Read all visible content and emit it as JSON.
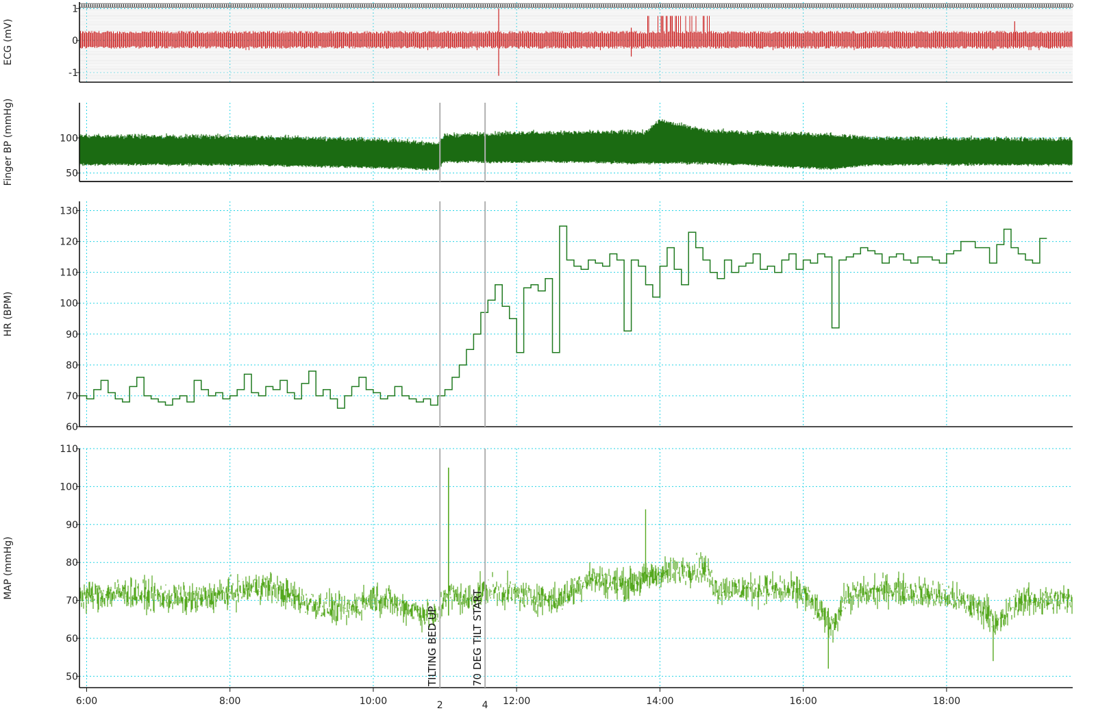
{
  "chart_data": {
    "type": "line",
    "x_tick_labels": [
      "6:00",
      "8:00",
      "10:00",
      "12:00",
      "14:00",
      "16:00",
      "18:00"
    ],
    "x_tick_hours": [
      6,
      8,
      10,
      12,
      14,
      16,
      18
    ],
    "x_range_hours": [
      5.9,
      19.76
    ],
    "grid": true,
    "colors": {
      "ecg": "#cc2222",
      "finger_bp": "#1b6b12",
      "hr": "#1f7a1f",
      "map": "#55a81e",
      "grid": "#22d3e6",
      "marker": "#b0b0b0"
    },
    "markers": [
      {
        "id": "2",
        "number": "2",
        "hour": 10.93,
        "label": "TILTING BED UP"
      },
      {
        "id": "4",
        "number": "4",
        "hour": 11.56,
        "label": "70 DEG TILT START"
      }
    ],
    "panels": [
      {
        "key": "ecg",
        "ylabel": "ECG (mV)",
        "ylim": [
          -1.3,
          1.2
        ],
        "yticks": [
          -1,
          0,
          1
        ],
        "ytick_labels": [
          "-1",
          "0",
          "1"
        ]
      },
      {
        "key": "finger_bp",
        "ylabel": "Finger BP (mmHg)",
        "ylim": [
          38,
          150
        ],
        "yticks": [
          50,
          100
        ],
        "ytick_labels": [
          "50",
          "100"
        ]
      },
      {
        "key": "hr",
        "ylabel": "HR (BPM)",
        "ylim": [
          60,
          133
        ],
        "yticks": [
          60,
          70,
          80,
          90,
          100,
          110,
          120,
          130
        ],
        "ytick_labels": [
          "60",
          "70",
          "80",
          "90",
          "100",
          "110",
          "120",
          "130"
        ],
        "series": {
          "name": "",
          "step": true,
          "x": [
            5.9,
            6.0,
            6.1,
            6.2,
            6.3,
            6.4,
            6.5,
            6.6,
            6.7,
            6.8,
            6.9,
            7.0,
            7.1,
            7.2,
            7.3,
            7.4,
            7.5,
            7.6,
            7.7,
            7.8,
            7.9,
            8.0,
            8.1,
            8.2,
            8.3,
            8.4,
            8.5,
            8.6,
            8.7,
            8.8,
            8.9,
            9.0,
            9.1,
            9.2,
            9.3,
            9.4,
            9.5,
            9.6,
            9.7,
            9.8,
            9.9,
            10.0,
            10.1,
            10.2,
            10.3,
            10.4,
            10.5,
            10.6,
            10.7,
            10.8,
            10.9,
            11.0,
            11.1,
            11.2,
            11.3,
            11.4,
            11.5,
            11.6,
            11.7,
            11.8,
            11.9,
            12.0,
            12.1,
            12.2,
            12.3,
            12.4,
            12.5,
            12.6,
            12.7,
            12.8,
            12.9,
            13.0,
            13.1,
            13.2,
            13.3,
            13.4,
            13.5,
            13.6,
            13.7,
            13.8,
            13.9,
            14.0,
            14.1,
            14.2,
            14.3,
            14.4,
            14.5,
            14.6,
            14.7,
            14.8,
            14.9,
            15.0,
            15.1,
            15.2,
            15.3,
            15.4,
            15.5,
            15.6,
            15.7,
            15.8,
            15.9,
            16.0,
            16.1,
            16.2,
            16.3,
            16.4,
            16.5,
            16.6,
            16.7,
            16.8,
            16.9,
            17.0,
            17.1,
            17.2,
            17.3,
            17.4,
            17.5,
            17.6,
            17.7,
            17.8,
            17.9,
            18.0,
            18.1,
            18.2,
            18.3,
            18.4,
            18.5,
            18.6,
            18.7,
            18.8,
            18.9,
            19.0,
            19.1,
            19.2,
            19.3,
            19.4,
            19.5,
            19.6,
            19.7
          ],
          "y": [
            70,
            69,
            72,
            75,
            71,
            69,
            68,
            73,
            76,
            70,
            69,
            68,
            67,
            69,
            70,
            68,
            75,
            72,
            70,
            71,
            69,
            70,
            72,
            77,
            71,
            70,
            73,
            72,
            75,
            71,
            69,
            74,
            78,
            70,
            72,
            69,
            66,
            70,
            73,
            76,
            72,
            71,
            69,
            70,
            73,
            70,
            69,
            68,
            69,
            67,
            70,
            72,
            76,
            80,
            85,
            90,
            97,
            101,
            106,
            99,
            95,
            84,
            105,
            106,
            104,
            108,
            84,
            125,
            114,
            112,
            111,
            114,
            113,
            112,
            116,
            114,
            91,
            114,
            112,
            106,
            102,
            112,
            118,
            111,
            106,
            123,
            118,
            114,
            110,
            108,
            114,
            110,
            112,
            113,
            116,
            111,
            112,
            110,
            114,
            116,
            111,
            114,
            113,
            116,
            115,
            92,
            114,
            115,
            116,
            118,
            117,
            116,
            113,
            115,
            116,
            114,
            113,
            115,
            115,
            114,
            113,
            116,
            117,
            120,
            120,
            118,
            118,
            113,
            119,
            124,
            118,
            116,
            114,
            113,
            121
          ]
        }
      },
      {
        "key": "map",
        "ylabel": "MAP (mmHg)",
        "ylim": [
          47,
          110
        ],
        "yticks": [
          50,
          60,
          70,
          80,
          90,
          100,
          110
        ],
        "ytick_labels": [
          "50",
          "60",
          "70",
          "80",
          "90",
          "100",
          "110"
        ]
      }
    ]
  }
}
